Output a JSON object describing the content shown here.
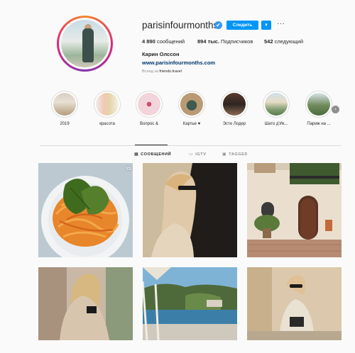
{
  "profile": {
    "username": "parisinfourmonths",
    "verified_mark": "✔",
    "follow_label": "Следить",
    "dropdown_glyph": "▾",
    "more_glyph": "···",
    "posts_count": "4 890",
    "posts_label": "сообщений",
    "followers_count": "894 тыс.",
    "followers_label": "Подписчиков",
    "following_count": "542",
    "following_label": "следующий",
    "full_name": "Карин Олссон",
    "website": "www.parisinfourmonths.com",
    "followed_prefix": "Вслед за",
    "followed_by": "friends.travel"
  },
  "highlights": [
    {
      "label": "2019"
    },
    {
      "label": "красота"
    },
    {
      "label": "Вопрос &"
    },
    {
      "label": "Картье ♥"
    },
    {
      "label": "Эсте Лодер"
    },
    {
      "label": "Шато д'Ик..."
    },
    {
      "label": "Париж на ..."
    }
  ],
  "highlight_next_glyph": "›",
  "tabs": {
    "posts": {
      "label": "СООБЩЕНИЙ",
      "icon": "grid-icon",
      "glyph": "▦"
    },
    "igtv": {
      "label": "IGTV",
      "icon": "tv-icon",
      "glyph": "▭"
    },
    "tagged": {
      "label": "TAGGED",
      "icon": "tag-icon",
      "glyph": "▣"
    }
  },
  "multi_post_glyph": "⧉",
  "colors": {
    "accent": "#0095f6",
    "link": "#00376b",
    "muted": "#8e8e8e"
  }
}
